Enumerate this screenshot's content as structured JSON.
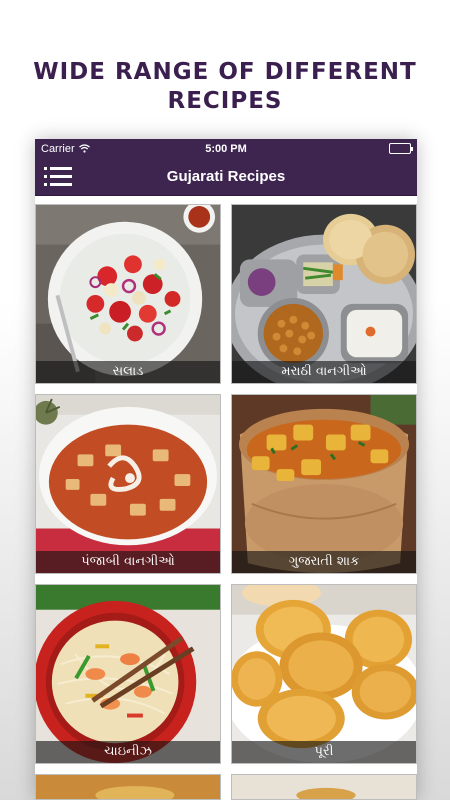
{
  "headline": "WIDE RANGE OF DIFFERENT\nRECIPES",
  "statusbar": {
    "carrier": "Carrier",
    "time": "5:00 PM"
  },
  "navbar": {
    "title": "Gujarati Recipes",
    "menu_icon": "hamburger-menu-icon"
  },
  "colors": {
    "bar": "#3d2550",
    "headline": "#3a1f4f"
  },
  "tiles": [
    {
      "label": "સલાડ",
      "image": "salad"
    },
    {
      "label": "મરાઠી વાનગીઓ",
      "image": "marathi-thali"
    },
    {
      "label": "પંજાબી વાનગીઓ",
      "image": "paneer-curry"
    },
    {
      "label": "ગુજરાતી શાક",
      "image": "potato-curry"
    },
    {
      "label": "ચાઇનીઝ",
      "image": "noodles"
    },
    {
      "label": "પૂરી",
      "image": "puri"
    }
  ]
}
